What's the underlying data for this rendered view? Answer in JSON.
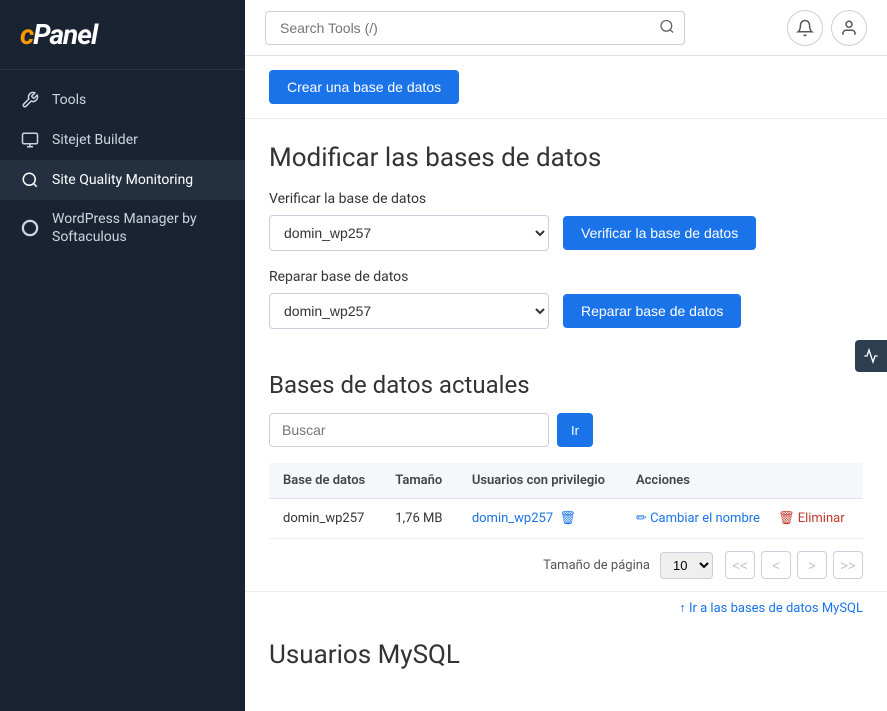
{
  "sidebar": {
    "logo": "cPanel",
    "logo_c": "c",
    "logo_panel": "Panel",
    "items": [
      {
        "id": "tools",
        "label": "Tools",
        "icon": "tools-icon"
      },
      {
        "id": "sitejet",
        "label": "Sitejet Builder",
        "icon": "sitejet-icon"
      },
      {
        "id": "site-quality",
        "label": "Site Quality Monitoring",
        "icon": "quality-icon",
        "active": true
      },
      {
        "id": "wordpress",
        "label": "WordPress Manager by Softaculous",
        "icon": "wordpress-icon"
      }
    ]
  },
  "header": {
    "search_placeholder": "Search Tools (/)"
  },
  "content": {
    "create_button_label": "Crear una base de datos",
    "modify_section_title": "Modificar las bases de datos",
    "verify_label": "Verificar la base de datos",
    "verify_select_value": "domin_wp257",
    "verify_button_label": "Verificar la base de datos",
    "repair_label": "Reparar base de datos",
    "repair_select_value": "domin_wp257",
    "repair_button_label": "Reparar base de datos",
    "current_section_title": "Bases de datos actuales",
    "search_placeholder": "Buscar",
    "go_button_label": "Ir",
    "table": {
      "headers": [
        "Base de datos",
        "Tamaño",
        "Usuarios con privilegio",
        "Acciones"
      ],
      "rows": [
        {
          "db_name": "domin_wp257",
          "size": "1,76 MB",
          "user": "domin_wp257",
          "action_rename": "Cambiar el nombre",
          "action_delete": "Eliminar"
        }
      ]
    },
    "pagination": {
      "page_size_label": "Tamaño de página",
      "page_size_value": "10",
      "btn_first": "<<",
      "btn_prev": "<",
      "btn_next": ">",
      "btn_last": ">>"
    },
    "mysql_link_label": "↑ Ir a las bases de datos MySQL",
    "mysql_users_title": "Usuarios MySQL"
  },
  "analytics_fab_icon": "chart-icon"
}
